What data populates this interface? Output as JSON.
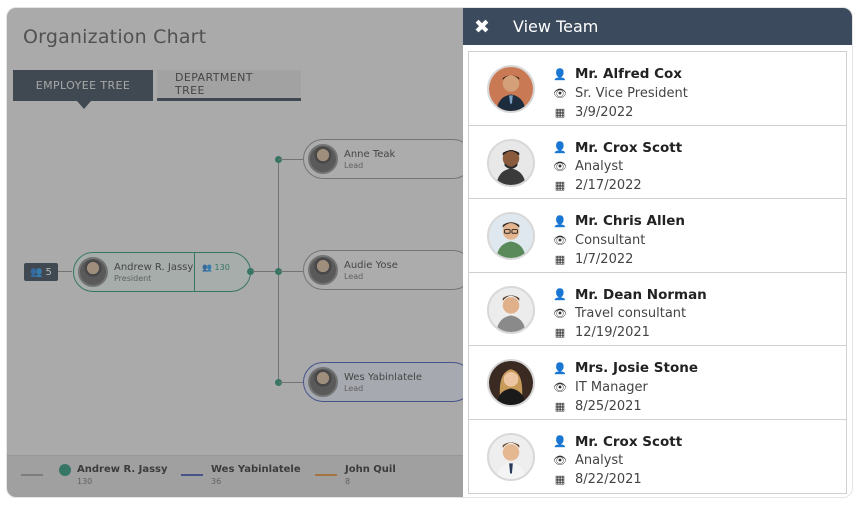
{
  "page": {
    "title": "Organization Chart"
  },
  "tabs": [
    {
      "label": "EMPLOYEE TREE",
      "active": true
    },
    {
      "label": "DEPARTMENT TREE",
      "active": false
    }
  ],
  "tree": {
    "root": {
      "name": "Andrew R. Jassy",
      "role": "President",
      "team_count": "130"
    },
    "root_badge": "5",
    "children": [
      {
        "name": "Anne Teak",
        "role": "Lead"
      },
      {
        "name": "Audie Yose",
        "role": "Lead"
      },
      {
        "name": "Wes Yabinlatele",
        "role": "Lead"
      }
    ]
  },
  "legend": [
    {
      "name": "Andrew R. Jassy",
      "count": "130"
    },
    {
      "name": "Wes Yabinlatele",
      "count": "36"
    },
    {
      "name": "John Quil",
      "count": "8"
    }
  ],
  "panel": {
    "title": "View Team",
    "members": [
      {
        "name": "Mr. Alfred Cox",
        "role": "Sr. Vice President",
        "date": "3/9/2022"
      },
      {
        "name": "Mr. Crox Scott",
        "role": "Analyst",
        "date": "2/17/2022"
      },
      {
        "name": "Mr. Chris Allen",
        "role": "Consultant",
        "date": "1/7/2022"
      },
      {
        "name": "Mr. Dean Norman",
        "role": "Travel consultant",
        "date": "12/19/2021"
      },
      {
        "name": "Mrs. Josie Stone",
        "role": "IT Manager",
        "date": "8/25/2021"
      },
      {
        "name": "Mr. Crox Scott",
        "role": "Analyst",
        "date": "8/22/2021"
      }
    ]
  },
  "colors": {
    "header": "#3b4a5c",
    "tab_active": "#2b3a4a",
    "accent_green": "#1a8a6e",
    "accent_blue": "#3a4fb0",
    "accent_orange": "#e08a2a"
  },
  "icons": {
    "close": "close-icon",
    "person": "user-icon",
    "role": "eye-icon",
    "date": "calendar-icon"
  }
}
